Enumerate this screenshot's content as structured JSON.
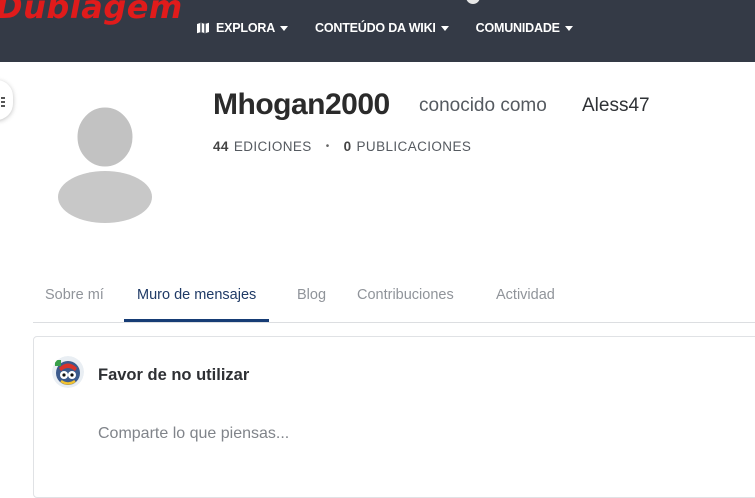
{
  "topbar": {
    "wiki_logo": "Dublagem",
    "nav": [
      {
        "label": "EXPLORA",
        "icon": "map-icon"
      },
      {
        "label": "CONTEÚDO DA WIKI"
      },
      {
        "label": "COMUNIDADE"
      }
    ]
  },
  "profile": {
    "username": "Mhogan2000",
    "aka_label": "conocido como",
    "alias": "Aless47",
    "edits_count": "44",
    "edits_label": "EDICIONES",
    "separator": "•",
    "posts_count": "0",
    "posts_label": "PUBLICACIONES"
  },
  "tabs": [
    {
      "label": "Sobre mí"
    },
    {
      "label": "Muro de mensajes",
      "active": true
    },
    {
      "label": "Blog"
    },
    {
      "label": "Contribuciones"
    },
    {
      "label": "Actividad"
    }
  ],
  "wall": {
    "title": "Favor de no utilizar",
    "placeholder": "Comparte lo que piensas..."
  },
  "colors": {
    "topbar_bg": "#343a46",
    "logo_red": "#e01b1b",
    "active_tab": "#163c75"
  }
}
